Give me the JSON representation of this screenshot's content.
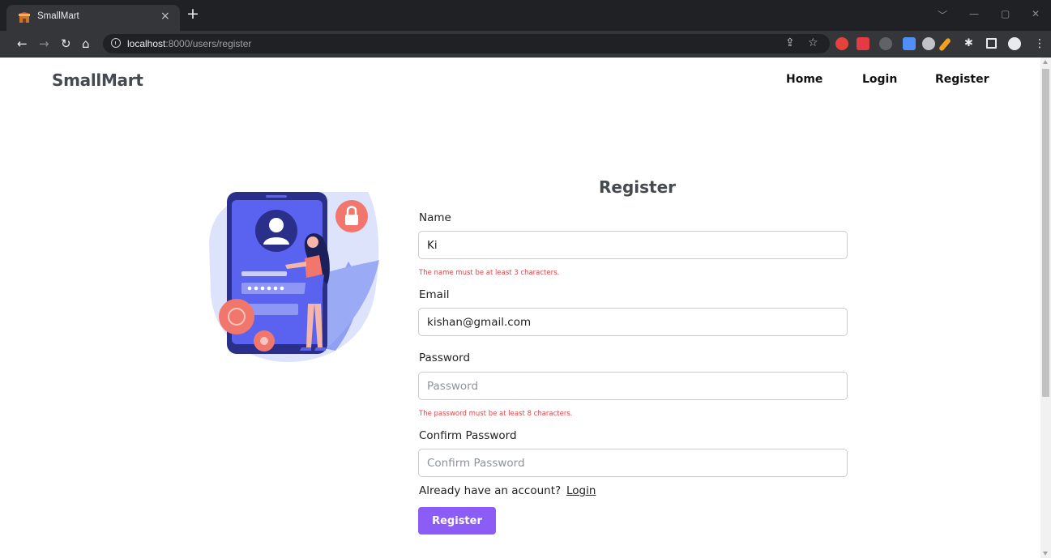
{
  "browser": {
    "tab_title": "SmallMart",
    "tab_close": "×",
    "new_tab": "+",
    "url_host": "localhost",
    "url_path": ":8000/users/register",
    "window_controls": [
      "﹀",
      "—",
      "▢",
      "✕"
    ]
  },
  "nav": {
    "brand": "SmallMart",
    "links": [
      "Home",
      "Login",
      "Register"
    ]
  },
  "form": {
    "title": "Register",
    "name": {
      "label": "Name",
      "value": "Ki",
      "error": "The name must be at least 3 characters."
    },
    "email": {
      "label": "Email",
      "value": "kishan@gmail.com"
    },
    "password": {
      "label": "Password",
      "placeholder": "Password",
      "error": "The password must be at least 8 characters."
    },
    "confirm": {
      "label": "Confirm Password",
      "placeholder": "Confirm Password"
    },
    "already_text": "Already have an account?",
    "login_link": "Login",
    "submit": "Register"
  },
  "colors": {
    "accent": "#8b5cf6",
    "error": "#e0474c",
    "brand": "#444a50",
    "illustration_blue": "#5963f0",
    "illustration_coral": "#f1776d"
  }
}
